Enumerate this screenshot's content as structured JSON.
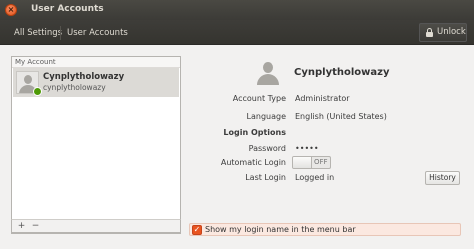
{
  "window": {
    "title": "User Accounts",
    "close_glyph": "×"
  },
  "toolbar": {
    "all_settings": "All Settings",
    "current": "User Accounts",
    "unlock": "Unlock"
  },
  "accounts": {
    "header": "My Account",
    "items": [
      {
        "name": "Cynplytholowazy",
        "username": "cynplytholowazy",
        "status": "online"
      }
    ],
    "add_glyph": "+",
    "remove_glyph": "−"
  },
  "detail": {
    "full_name": "Cynplytholowazy",
    "account_type_label": "Account Type",
    "account_type_value": "Administrator",
    "language_label": "Language",
    "language_value": "English (United States)",
    "login_options_title": "Login Options",
    "password_label": "Password",
    "password_value": "•••••",
    "auto_login_label": "Automatic Login",
    "auto_login_state": "OFF",
    "last_login_label": "Last Login",
    "last_login_value": "Logged in",
    "history_button": "History",
    "show_login_name_label": "Show my login name in the menu bar",
    "show_login_name_checked": true
  },
  "colors": {
    "accent": "#e95420",
    "titlebar": "#3c3b37",
    "online": "#4e9a06"
  }
}
